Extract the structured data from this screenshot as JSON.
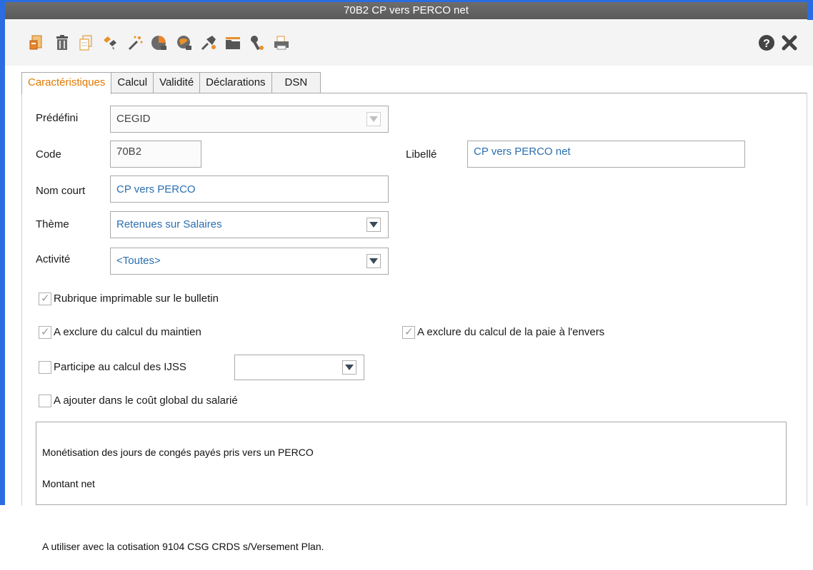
{
  "window": {
    "title": "70B2 CP vers PERCO net"
  },
  "toolbar": {
    "icons": [
      "new-doc-icon",
      "trash-icon",
      "copy-icon",
      "link-icon",
      "magic-wand-icon",
      "chart-icon",
      "web-icon",
      "pin-icon",
      "folder-icon",
      "wrench-icon",
      "printer-icon",
      "help-icon",
      "close-icon"
    ]
  },
  "tabs": [
    "Caractéristiques",
    "Calcul",
    "Validité",
    "Déclarations",
    "DSN"
  ],
  "form": {
    "predefini_label": "Prédéfini",
    "predefini_value": "CEGID",
    "code_label": "Code",
    "code_value": "70B2",
    "libelle_label": "Libellé",
    "libelle_value": "CP vers PERCO net",
    "nomcourt_label": "Nom court",
    "nomcourt_value": "CP vers PERCO",
    "theme_label": "Thème",
    "theme_value": "Retenues sur Salaires",
    "activite_label": "Activité",
    "activite_value": "<Toutes>"
  },
  "checks": {
    "imprimable": {
      "label": "Rubrique imprimable sur le bulletin",
      "checked": true
    },
    "exclure_maintien": {
      "label": "A exclure du calcul du maintien",
      "checked": true
    },
    "exclure_envers": {
      "label": "A exclure du calcul de la paie à l'envers",
      "checked": true
    },
    "ijss": {
      "label": "Participe au calcul des IJSS",
      "checked": false
    },
    "cout_global": {
      "label": "A ajouter dans le coût global du salarié",
      "checked": false
    }
  },
  "memo": {
    "line1": "Monétisation des jours de congés payés pris vers un PERCO",
    "line2": "Montant net",
    "line3": "",
    "line4": "A utiliser avec la cotisation 9104 CSG CRDS s/Versement Plan."
  },
  "colors": {
    "accent_tab": "#e07800",
    "window_frame": "#2b6de0",
    "field_text": "#2a6fb0"
  }
}
